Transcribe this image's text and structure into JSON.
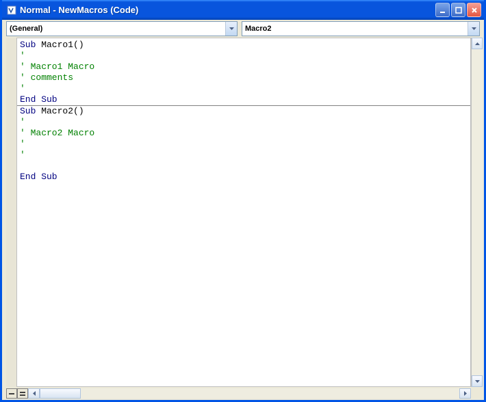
{
  "window": {
    "title": "Normal - NewMacros (Code)"
  },
  "dropdowns": {
    "object": "(General)",
    "procedure": "Macro2"
  },
  "code": {
    "lines": [
      {
        "type": "code",
        "tokens": [
          {
            "t": "kw",
            "v": "Sub"
          },
          {
            "t": "plain",
            "v": " Macro1()"
          }
        ]
      },
      {
        "type": "comment",
        "text": "'"
      },
      {
        "type": "comment",
        "text": "' Macro1 Macro"
      },
      {
        "type": "comment",
        "text": "' comments"
      },
      {
        "type": "comment",
        "text": "'"
      },
      {
        "type": "code",
        "tokens": [
          {
            "t": "kw",
            "v": "End Sub"
          }
        ]
      },
      {
        "type": "divider"
      },
      {
        "type": "code",
        "tokens": [
          {
            "t": "kw",
            "v": "Sub"
          },
          {
            "t": "plain",
            "v": " Macro2()"
          }
        ]
      },
      {
        "type": "comment",
        "text": "'"
      },
      {
        "type": "comment",
        "text": "' Macro2 Macro"
      },
      {
        "type": "comment",
        "text": "'"
      },
      {
        "type": "comment",
        "text": "'"
      },
      {
        "type": "blank"
      },
      {
        "type": "code",
        "tokens": [
          {
            "t": "kw",
            "v": "End Sub"
          }
        ]
      }
    ]
  }
}
